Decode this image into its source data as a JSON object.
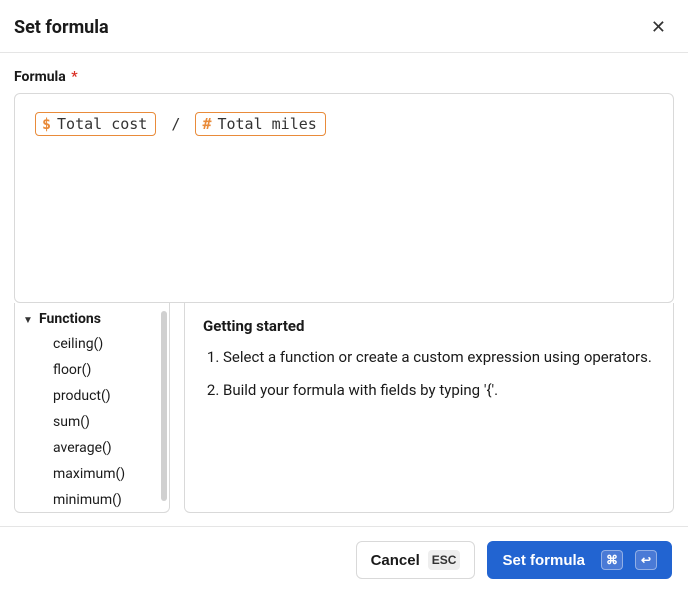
{
  "header": {
    "title": "Set formula"
  },
  "field": {
    "label": "Formula",
    "required": "*"
  },
  "formula": {
    "tokens": [
      {
        "sym": "$",
        "text": "Total cost"
      },
      {
        "sym": "#",
        "text": "Total miles"
      }
    ],
    "operator": "/"
  },
  "functions": {
    "header": "Functions",
    "items": [
      "ceiling()",
      "floor()",
      "product()",
      "sum()",
      "average()",
      "maximum()",
      "minimum()"
    ]
  },
  "help": {
    "title": "Getting started",
    "step1": "Select a function or create a custom expression using operators.",
    "step2": "Build your formula with fields by typing '{'."
  },
  "footer": {
    "cancel": "Cancel",
    "cancel_key": "ESC",
    "submit": "Set formula",
    "submit_key1": "⌘",
    "submit_key2": "↩"
  }
}
